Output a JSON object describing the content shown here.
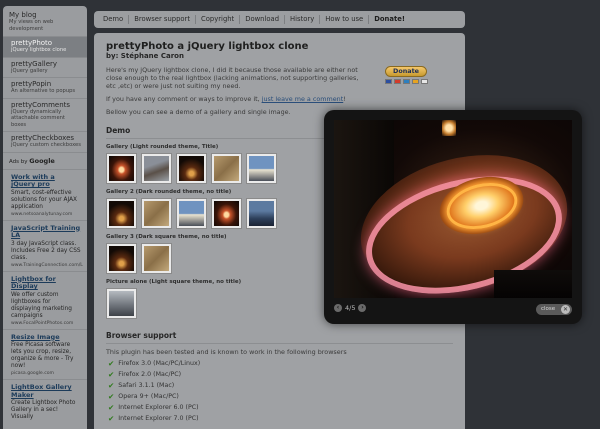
{
  "sidebar": {
    "blog_title": "My blog",
    "blog_sub": "My views on web development",
    "items": [
      {
        "label": "prettyPhoto",
        "sub": "jQuery lightbox clone"
      },
      {
        "label": "prettyGallery",
        "sub": "jQuery gallery"
      },
      {
        "label": "prettyPopin",
        "sub": "An alternative to popups"
      },
      {
        "label": "prettyComments",
        "sub": "jQuery dynamically attachable comment boxes"
      },
      {
        "label": "prettyCheckboxes",
        "sub": "jQuery custom checkboxes"
      }
    ],
    "ads_by": "Ads by",
    "ads_brand": "Google",
    "ads": [
      {
        "title": "Work with a jQuery pro",
        "desc": "Smart, cost-effective solutions for your AJAX application",
        "url": "www.netsoanalytunay.com"
      },
      {
        "title": "JavaScript Training LA",
        "desc": "3 day JavaScript class. Includes Free 2 day CSS class.",
        "url": "www.TrainingConnection.com/L"
      },
      {
        "title": "Lightbox for Display",
        "desc": "We offer custom lightboxes for displaying marketing campaigns",
        "url": "www.FocalPointPhotos.com"
      },
      {
        "title": "Resize Image",
        "desc": "Free Picasa software lets you crop, resize, organize & more - Try now!",
        "url": "picasa.google.com"
      },
      {
        "title": "LightBox Gallery Maker",
        "desc": "Create Lightbox Photo Gallery in a sec! Visually",
        "url": ""
      }
    ]
  },
  "topnav": [
    "Demo",
    "Browser support",
    "Copyright",
    "Download",
    "History",
    "How to use",
    "Donate!"
  ],
  "main": {
    "title": "prettyPhoto a jQuery lightbox clone",
    "byline": "by: Stéphane Caron",
    "intro": "Here's my jQuery lightbox clone, I did it because those available are either not close enough to the real lightbox (lacking animations, not supporting galleries, etc ,etc) or were just not suiting my need.",
    "comment_pre": "If you have any comment or ways to improve it, ",
    "comment_link": "just leave me a comment",
    "comment_post": "!",
    "below": "Bellow you can see a demo of a gallery and single image.",
    "donate_label": "Donate",
    "demo_heading": "Demo",
    "gallery1": "Gallery (Light rounded theme, Title)",
    "gallery2": "Gallery 2 (Dark rounded theme, no title)",
    "gallery3": "Gallery 3 (Dark square theme, no title)",
    "picture_alone": "Picture alone (Light square theme, no title)",
    "browser_heading": "Browser support",
    "browser_intro": "This plugin has been tested and is known to work in the following browsers",
    "browsers": [
      "Firefox 3.0 (Mac/PC/Linux)",
      "Firefox 2.0 (Mac/PC)",
      "Safari 3.1.1 (Mac)",
      "Opera 9+ (Mac/PC)",
      "Internet Explorer 6.0 (PC)",
      "Internet Explorer 7.0 (PC)"
    ]
  },
  "lightbox": {
    "counter": "4/5",
    "close_label": "close",
    "prev_icon": "‹",
    "next_icon": "›",
    "close_icon": "✕"
  }
}
